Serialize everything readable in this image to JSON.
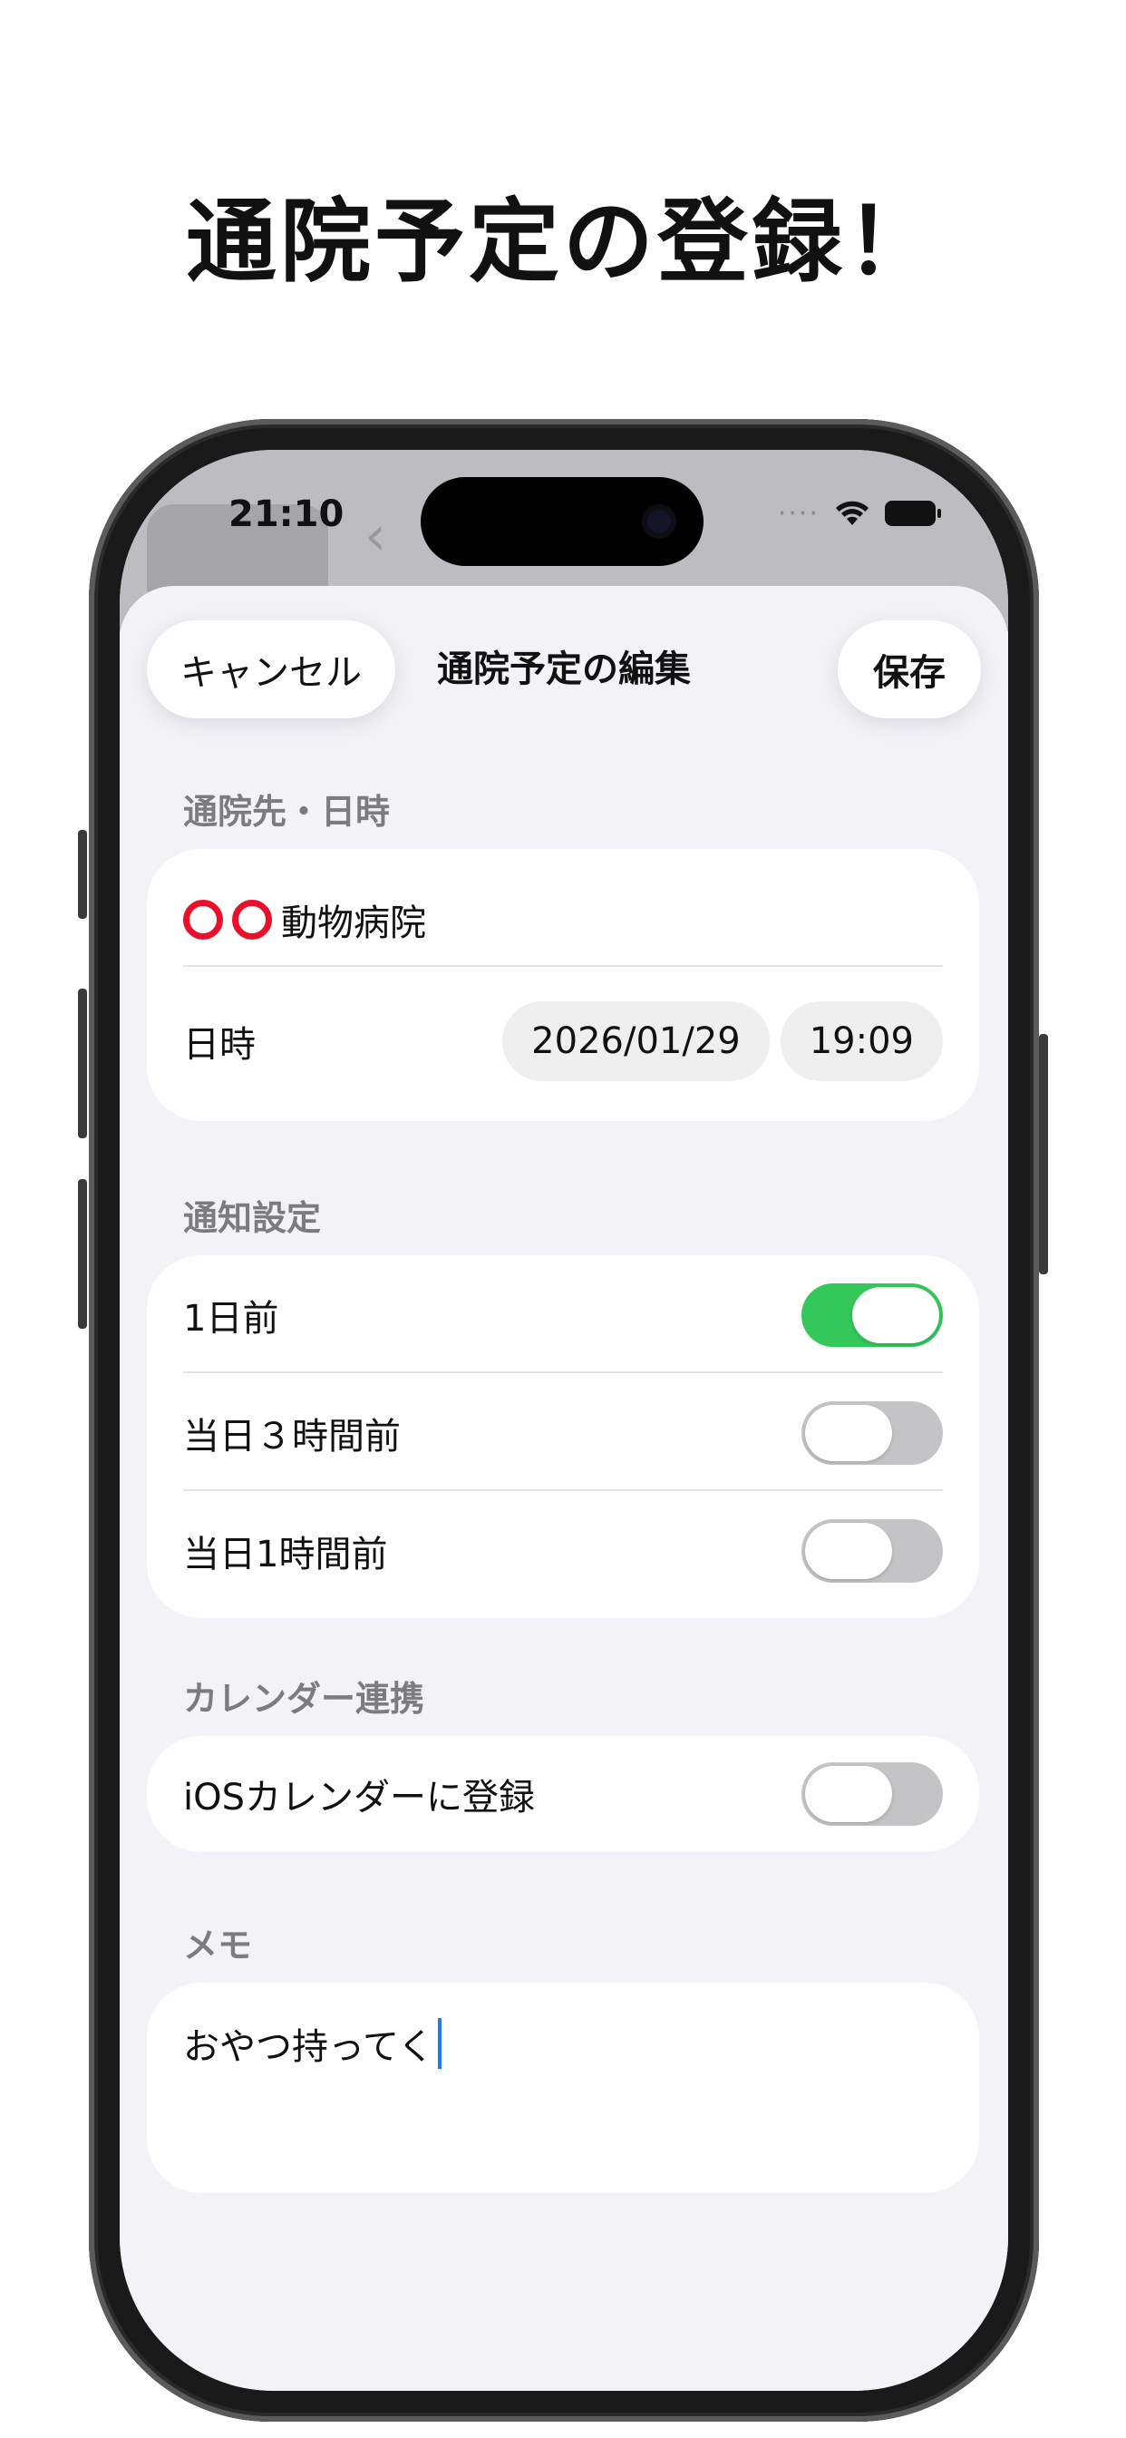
{
  "promo": {
    "headline": "通院予定の登録！"
  },
  "status_bar": {
    "time": "21:10"
  },
  "nav": {
    "cancel_label": "キャンセル",
    "title": "通院予定の編集",
    "save_label": "保存"
  },
  "sections": {
    "visit": {
      "header": "通院先・日時",
      "hospital_name": "動物病院",
      "hospital_prefix_symbol": "〇〇",
      "datetime_label": "日時",
      "date_value": "2026/01/29",
      "time_value": "19:09"
    },
    "notification": {
      "header": "通知設定",
      "items": [
        {
          "label": "1日前",
          "on": true
        },
        {
          "label": "当日３時間前",
          "on": false
        },
        {
          "label": "当日1時間前",
          "on": false
        }
      ]
    },
    "calendar": {
      "header": "カレンダー連携",
      "label": "iOSカレンダーに登録",
      "on": false
    },
    "memo": {
      "header": "メモ",
      "value": "おやつ持ってく"
    }
  },
  "colors": {
    "toggle_on": "#34c759",
    "toggle_off": "#c4c4c7",
    "caret": "#1a7cf5",
    "circle_mark": "#e8102a"
  }
}
